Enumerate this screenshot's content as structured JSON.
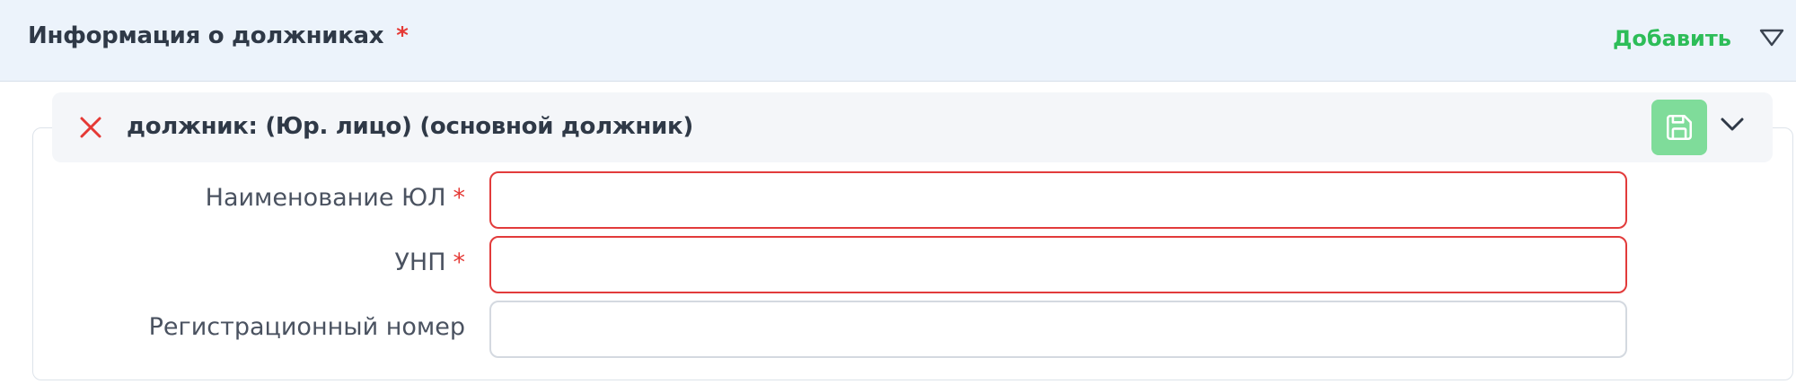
{
  "section": {
    "title": "Информация о должниках",
    "required_mark": "*",
    "add_label": "Добавить",
    "toggle_icon": "triangle-down-outline-icon"
  },
  "debtor": {
    "title": "должник: (Юр. лицо) (основной должник)",
    "remove_icon": "close-icon",
    "save_icon": "save-icon",
    "expand_icon": "chevron-down-icon"
  },
  "fields": {
    "name": {
      "label": "Наименование ЮЛ",
      "required_mark": "*",
      "value": "",
      "placeholder": ""
    },
    "unp": {
      "label": "УНП",
      "required_mark": "*",
      "value": "",
      "placeholder": ""
    },
    "reg_number": {
      "label": "Регистрационный номер",
      "value": "",
      "placeholder": ""
    }
  },
  "colors": {
    "accent_green": "#2dbd58",
    "save_button": "#7fdc9a",
    "error_red": "#e53935",
    "header_bg": "#ecf3fb"
  }
}
